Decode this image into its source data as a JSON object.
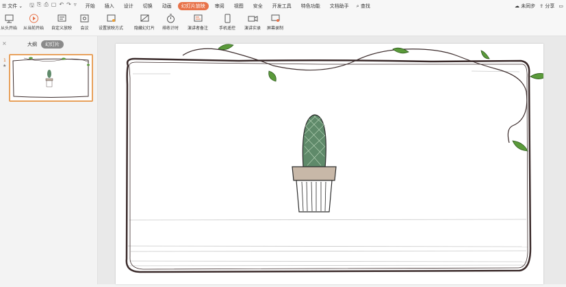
{
  "menubar": {
    "file_label": "文件",
    "tabs": [
      {
        "label": "开始",
        "active": false
      },
      {
        "label": "插入",
        "active": false
      },
      {
        "label": "设计",
        "active": false
      },
      {
        "label": "切换",
        "active": false
      },
      {
        "label": "动画",
        "active": false
      },
      {
        "label": "幻灯片放映",
        "active": true
      },
      {
        "label": "审阅",
        "active": false
      },
      {
        "label": "视图",
        "active": false
      },
      {
        "label": "安全",
        "active": false
      },
      {
        "label": "开发工具",
        "active": false
      },
      {
        "label": "特色功能",
        "active": false
      },
      {
        "label": "文档助手",
        "active": false
      }
    ],
    "search_label": "查找",
    "sync_label": "未同步",
    "share_label": "分享"
  },
  "toolbar": {
    "from_start": "从头开始",
    "from_current": "从当前开始",
    "custom_show": "自定义放映",
    "meeting": "会议",
    "setup_show": "设置放映方式",
    "hide_slide": "隐藏幻灯片",
    "rehearse": "排练计时",
    "presenter_notes": "演讲者备注",
    "phone_remote": "手机遥控",
    "record_live": "演讲实录",
    "screen_record": "屏幕录制"
  },
  "panel": {
    "tab_outline": "大纲",
    "tab_slides": "幻灯片",
    "slide_number": "1",
    "star": "★"
  },
  "colors": {
    "accent": "#e8734a",
    "thumb_border": "#e8a05a",
    "leaf": "#5a9a3a",
    "frame": "#3a2a2a"
  }
}
